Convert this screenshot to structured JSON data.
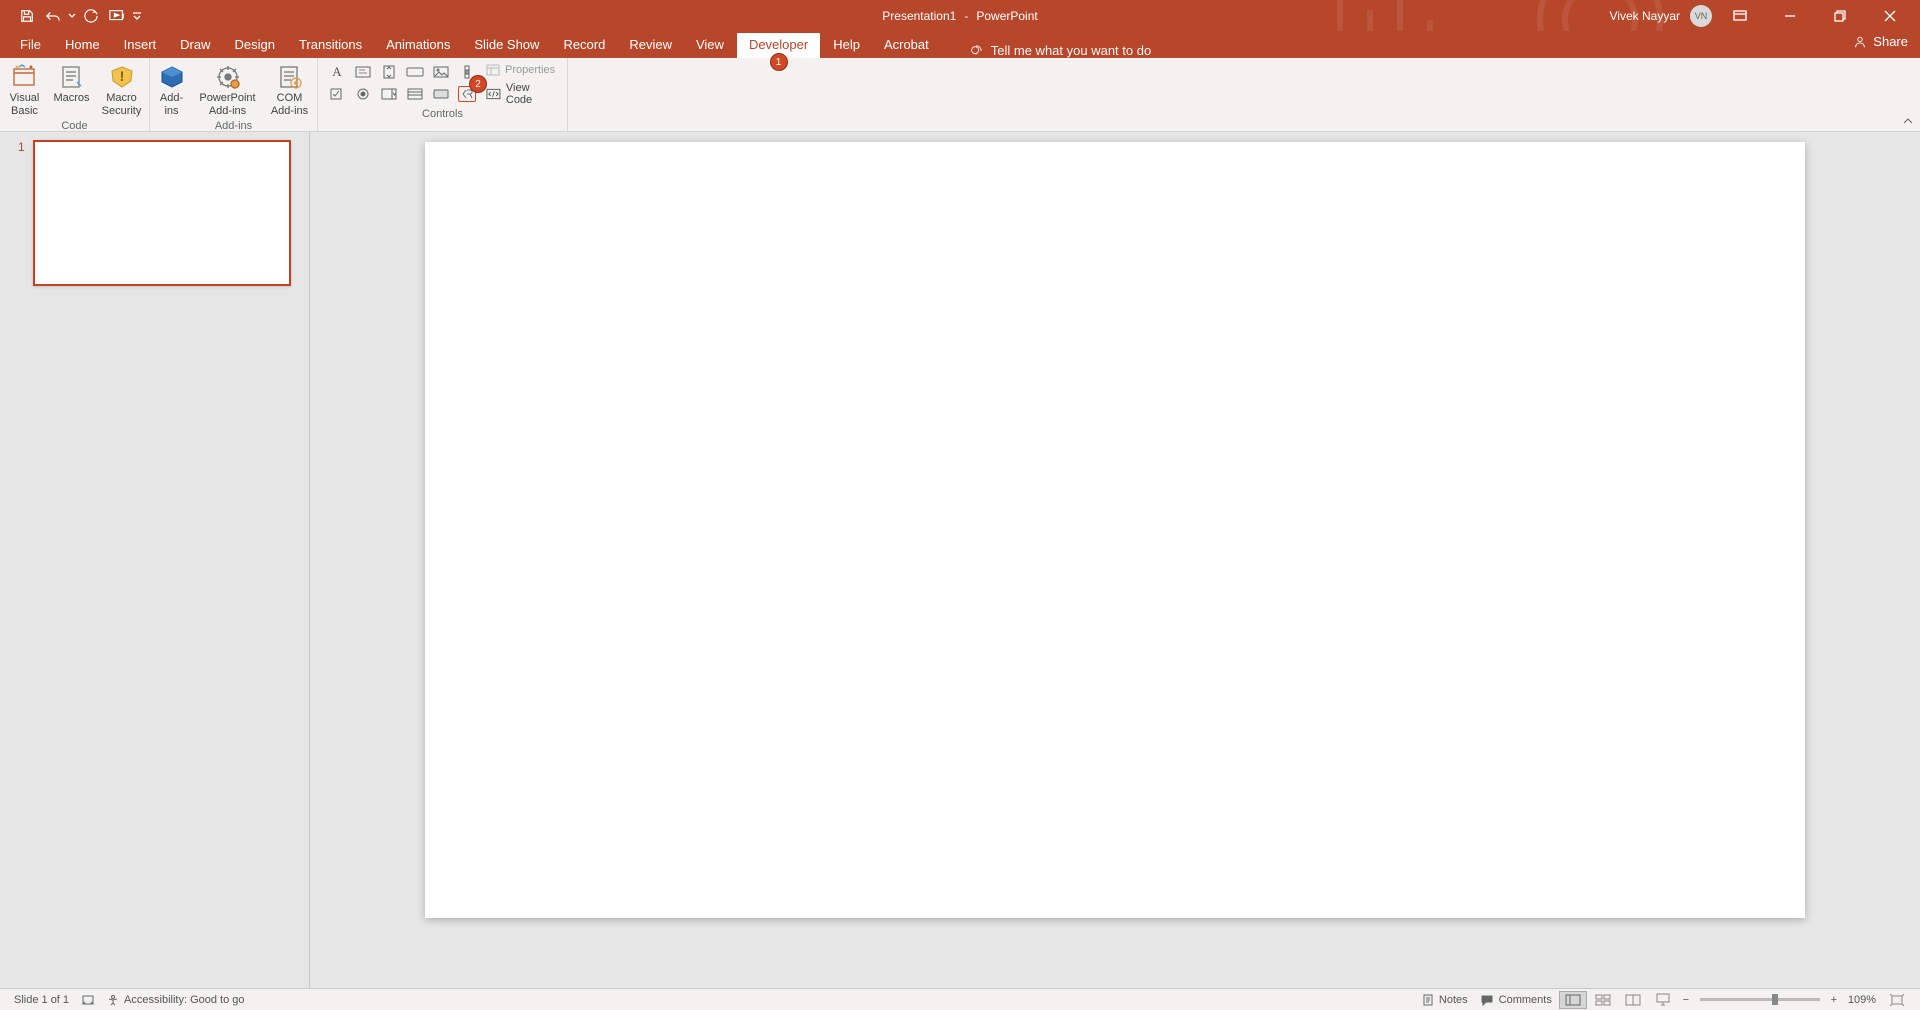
{
  "title": {
    "doc": "Presentation1",
    "app": "PowerPoint"
  },
  "user": {
    "name": "Vivek Nayyar",
    "initials": "VN"
  },
  "tabs": {
    "file": "File",
    "items": [
      "Home",
      "Insert",
      "Draw",
      "Design",
      "Transitions",
      "Animations",
      "Slide Show",
      "Record",
      "Review",
      "View",
      "Developer",
      "Help",
      "Acrobat"
    ],
    "active": "Developer",
    "tell_me": "Tell me what you want to do",
    "share": "Share"
  },
  "callouts": {
    "tab": "1",
    "control": "2"
  },
  "ribbon": {
    "code": {
      "visual_basic": "Visual\nBasic",
      "macros": "Macros",
      "macro_security": "Macro\nSecurity",
      "label": "Code"
    },
    "addins": {
      "addins": "Add-\nins",
      "ppt_addins": "PowerPoint\nAdd-ins",
      "com_addins": "COM\nAdd-ins",
      "label": "Add-ins"
    },
    "controls": {
      "properties": "Properties",
      "view_code": "View Code",
      "label": "Controls"
    }
  },
  "thumbs": {
    "first_index": "1"
  },
  "status": {
    "slide": "Slide 1 of 1",
    "accessibility": "Accessibility: Good to go",
    "notes": "Notes",
    "comments": "Comments",
    "zoom": "109%"
  }
}
